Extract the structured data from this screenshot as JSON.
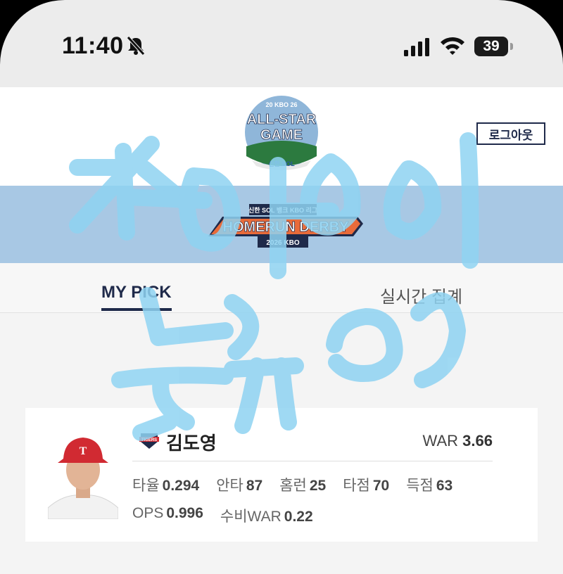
{
  "status_bar": {
    "time": "11:40",
    "battery": "39"
  },
  "header": {
    "logo_lines": [
      "20 KBO 26",
      "ALL-STAR",
      "GAME",
      "신한 SOL"
    ],
    "logout_label": "로그아웃"
  },
  "banner": {
    "title_top": "신한 SOL 뱅크 KBO 리그",
    "title_main": "HOMERUN DERBY",
    "year": "2026 KBO"
  },
  "tabs": [
    {
      "label": "MY PICK"
    },
    {
      "label": "실시간 집계"
    }
  ],
  "player": {
    "team": "TIGERS",
    "name": "김도영",
    "war_label": "WAR",
    "war_value": "3.66",
    "stats_row1": [
      {
        "label": "타율",
        "value": "0.294"
      },
      {
        "label": "안타",
        "value": "87"
      },
      {
        "label": "홈런",
        "value": "25"
      },
      {
        "label": "타점",
        "value": "70"
      },
      {
        "label": "득점",
        "value": "63"
      }
    ],
    "stats_row2": [
      {
        "label": "OPS",
        "value": "0.996"
      },
      {
        "label": "수비WAR",
        "value": "0.22"
      }
    ]
  },
  "colors": {
    "navy": "#1f2a4a",
    "banner": "#a8c8e4",
    "scribble": "#8fd3f2"
  }
}
